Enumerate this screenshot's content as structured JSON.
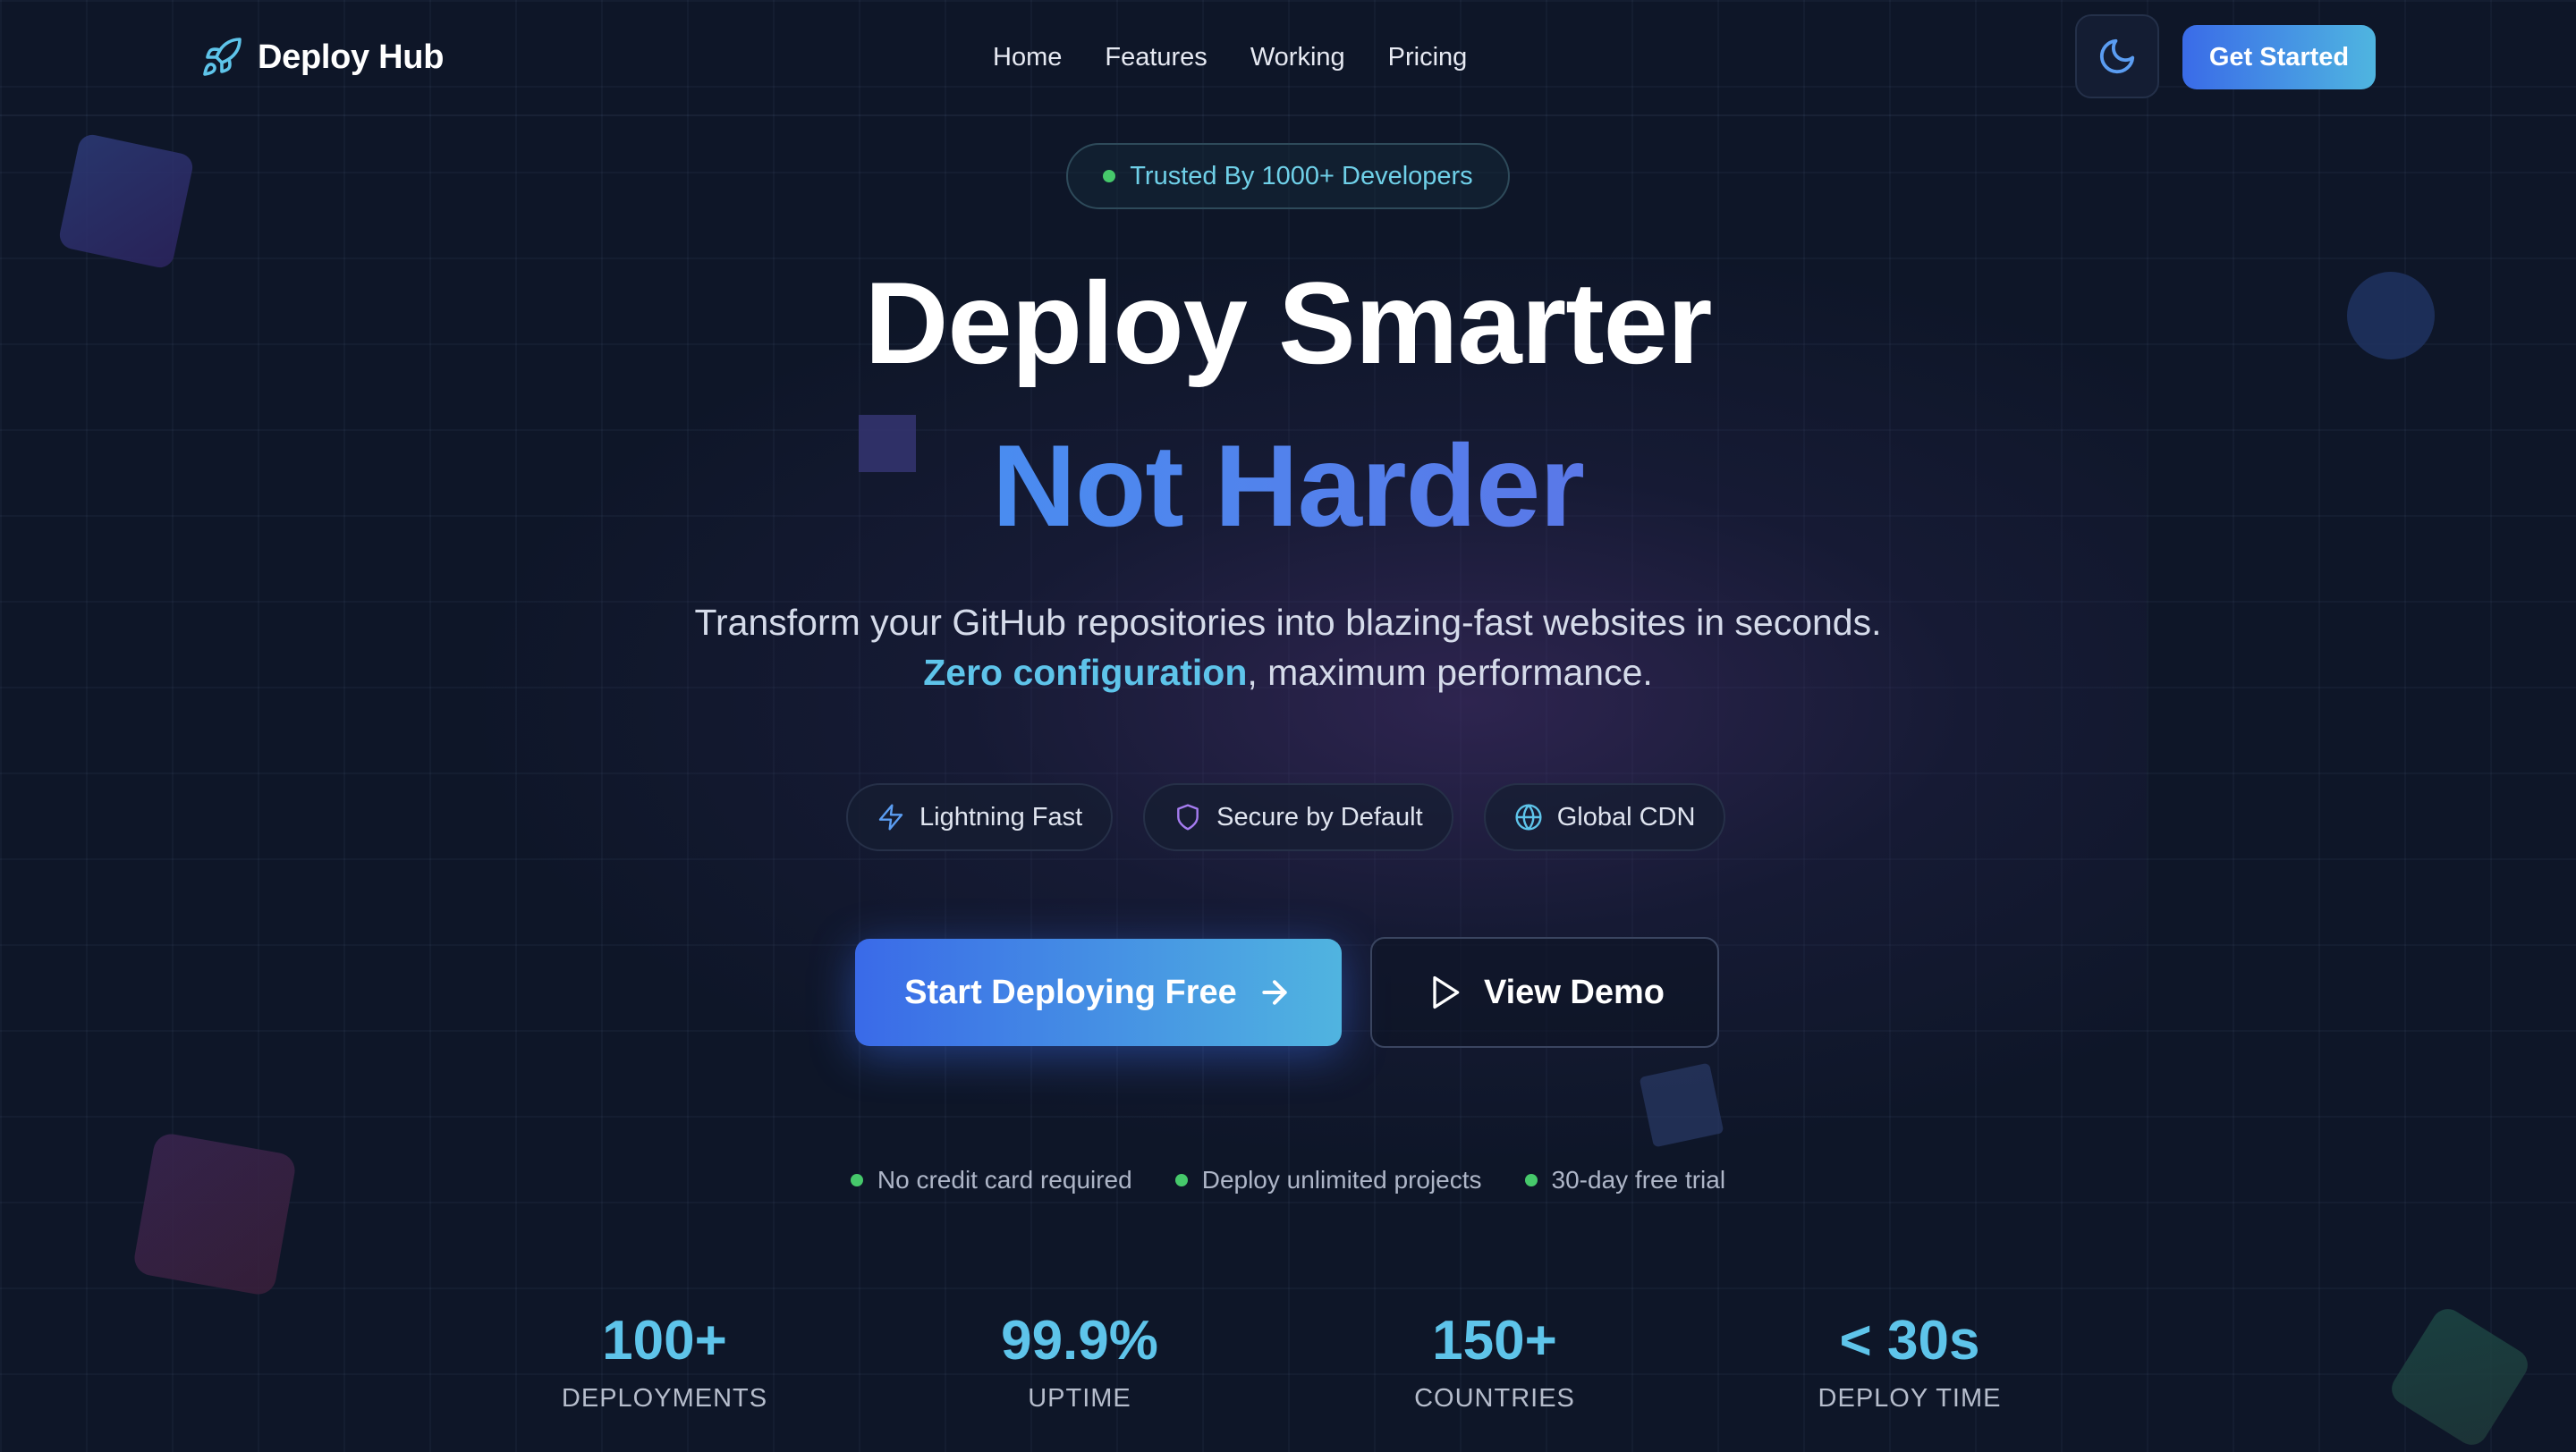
{
  "header": {
    "logo_text": "Deploy Hub",
    "logo_icon": "rocket-icon",
    "nav": [
      "Home",
      "Features",
      "Working",
      "Pricing"
    ],
    "theme_toggle_icon": "moon-icon",
    "cta_label": "Get Started"
  },
  "hero": {
    "badge": "Trusted By 1000+ Developers",
    "title_line1": "Deploy Smarter",
    "title_line2": "Not Harder",
    "subtitle_line1": "Transform your GitHub repositories into blazing-fast websites in seconds.",
    "subtitle_highlight": "Zero configuration",
    "subtitle_rest": ", maximum performance.",
    "pills": [
      {
        "label": "Lightning Fast",
        "icon": "lightning-icon"
      },
      {
        "label": "Secure by Default",
        "icon": "shield-icon"
      },
      {
        "label": "Global CDN",
        "icon": "globe-icon"
      }
    ],
    "primary_cta": "Start Deploying Free",
    "secondary_cta": "View Demo",
    "perks": [
      "No credit card required",
      "Deploy unlimited projects",
      "30-day free trial"
    ]
  },
  "stats": [
    {
      "value": "100+",
      "label": "DEPLOYMENTS"
    },
    {
      "value": "99.9%",
      "label": "UPTIME"
    },
    {
      "value": "150+",
      "label": "COUNTRIES"
    },
    {
      "value": "< 30s",
      "label": "DEPLOY TIME"
    }
  ],
  "colors": {
    "background": "#0e1628",
    "accent_blue": "#3a6be8",
    "accent_cyan": "#5ec4ea",
    "status_green": "#46c96b"
  }
}
